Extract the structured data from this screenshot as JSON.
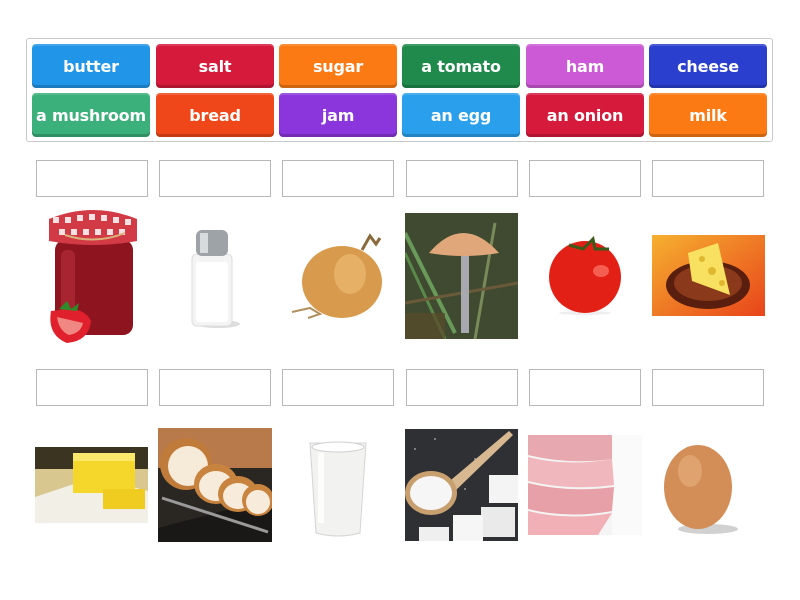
{
  "word_bank": {
    "tiles": [
      {
        "label": "butter",
        "color": "#2196e8"
      },
      {
        "label": "salt",
        "color": "#d61a3c"
      },
      {
        "label": "sugar",
        "color": "#fb7a13"
      },
      {
        "label": "a tomato",
        "color": "#1f8a4c"
      },
      {
        "label": "ham",
        "color": "#cc5ad6"
      },
      {
        "label": "cheese",
        "color": "#2b3fcf"
      },
      {
        "label": "a mushroom",
        "color": "#3bb07a"
      },
      {
        "label": "bread",
        "color": "#f0471a"
      },
      {
        "label": "jam",
        "color": "#8a36dc"
      },
      {
        "label": "an egg",
        "color": "#2aa0ec"
      },
      {
        "label": "an onion",
        "color": "#d61a3c"
      },
      {
        "label": "milk",
        "color": "#fb7a13"
      }
    ]
  },
  "pictures": {
    "row1": [
      "jam-image",
      "salt-image",
      "onion-image",
      "mushroom-image",
      "tomato-image",
      "cheese-image"
    ],
    "row2": [
      "butter-image",
      "bread-image",
      "milk-image",
      "sugar-image",
      "ham-image",
      "egg-image"
    ]
  }
}
